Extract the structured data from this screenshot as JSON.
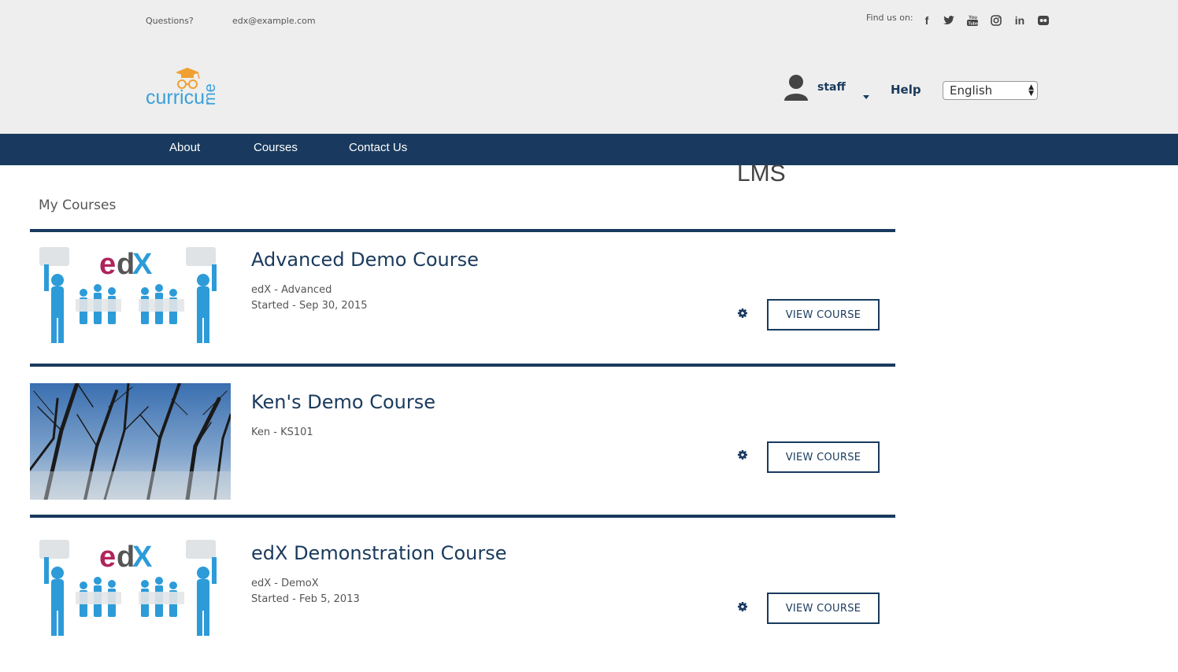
{
  "topbar": {
    "questions_label": "Questions?",
    "email": "edx@example.com",
    "find_us_label": "Find us on:",
    "social_icons": [
      "facebook-icon",
      "twitter-icon",
      "youtube-icon",
      "instagram-icon",
      "linkedin-icon",
      "flickr-icon"
    ]
  },
  "header": {
    "logo_text": "curricu.me",
    "username": "staff",
    "help_label": "Help",
    "language_selected": "English"
  },
  "nav": {
    "items": [
      {
        "label": "About"
      },
      {
        "label": "Courses"
      },
      {
        "label": "Contact Us"
      }
    ]
  },
  "main": {
    "lms_label": "LMS",
    "section_title": "My Courses",
    "courses": [
      {
        "title": "Advanced Demo Course",
        "org_code": "edX - Advanced",
        "started": "Started - Sep 30, 2015",
        "button_label": "VIEW COURSE",
        "thumbnail": "edx-puzzle-people"
      },
      {
        "title": "Ken's Demo Course",
        "org_code": "Ken - KS101",
        "started": "",
        "button_label": "VIEW COURSE",
        "thumbnail": "trees-sky-photo"
      },
      {
        "title": "edX Demonstration Course",
        "org_code": "edX - DemoX",
        "started": "Started - Feb 5, 2013",
        "button_label": "VIEW COURSE",
        "thumbnail": "edx-puzzle-people"
      }
    ]
  },
  "colors": {
    "navy": "#193a5e",
    "topbar_bg": "#eeeeee",
    "logo_blue": "#3aa0d8",
    "logo_orange": "#f0a030",
    "edx_magenta": "#b0245c",
    "edx_blue": "#2d9bd8"
  }
}
